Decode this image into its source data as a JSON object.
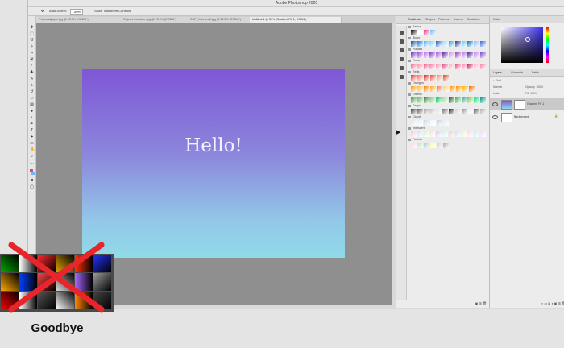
{
  "app": {
    "title": "Adobe Photoshop 2020",
    "traffic_colors": [
      "#ff5f57",
      "#febc2e",
      "#28c840"
    ]
  },
  "options_bar": {
    "auto_select": "Auto-Select:",
    "layer": "Layer",
    "show_transform": "Show Transform Controls"
  },
  "doc_tabs": [
    {
      "label": "Prismwallpaper.jpg @ 33.3% (RGB/8*)"
    },
    {
      "label": "Objects transform.jpg @ 25.0% (RGB/8*)"
    },
    {
      "label": "CGP_Hoursmall.jpg @ 25.0% (RGB/8*)"
    },
    {
      "label": "Untitled-1 @ 59% (Gradient Fill 1, RGB/8) *"
    }
  ],
  "canvas": {
    "text": "Hello!"
  },
  "gradients_panel": {
    "tabs": [
      "Gradients",
      "Shapes",
      "Patterns",
      "Layers",
      "Swatches"
    ],
    "groups": [
      {
        "name": "Basics",
        "colors": [
          "#000000",
          "#ffffff",
          "#e33b7a",
          "#6fb5ff"
        ]
      },
      {
        "name": "Blues",
        "colors": [
          "#0b4fa8",
          "#1e7ad6",
          "#58a8ee",
          "#7fd3f7",
          "#2a5fc4",
          "#9fd7ff",
          "#3aa0e0",
          "#1f3d8f",
          "#64c5e8",
          "#0e78b8",
          "#8fb8ff",
          "#3467d6"
        ]
      },
      {
        "name": "Purples",
        "colors": [
          "#6b2fbf",
          "#9a4de0",
          "#c06ae8",
          "#7c3fc2",
          "#a75bd9",
          "#5a27a8",
          "#d58cf0",
          "#8e44ad",
          "#b36be6",
          "#4b2c91",
          "#c77ff2",
          "#7a48d1"
        ]
      },
      {
        "name": "Pinks",
        "colors": [
          "#f06292",
          "#ff8a9c",
          "#e94d87",
          "#ff6f91",
          "#f48fb1",
          "#d8457e",
          "#ffa3b6",
          "#ec407a",
          "#ff7aa2",
          "#c2185b",
          "#ffb0c5",
          "#f57ba4"
        ]
      },
      {
        "name": "Reds",
        "colors": [
          "#e53935",
          "#ff6f61",
          "#c62828",
          "#f44336",
          "#ff8a65",
          "#d84315"
        ]
      },
      {
        "name": "Oranges",
        "colors": [
          "#ff9800",
          "#ffb74d",
          "#f57c00",
          "#ffa726",
          "#ff7043",
          "#ffcc80",
          "#fb8c00",
          "#ff8f00",
          "#ffb300",
          "#ef6c00"
        ]
      },
      {
        "name": "Greens",
        "colors": [
          "#43a047",
          "#66bb6a",
          "#2e7d32",
          "#81c784",
          "#00c853",
          "#a5d6a7",
          "#1b5e20",
          "#4caf50",
          "#26a69a",
          "#8bc34a",
          "#00e676",
          "#009688"
        ]
      },
      {
        "name": "Grays",
        "colors": [
          "#424242",
          "#616161",
          "#9e9e9e",
          "#bdbdbd",
          "#e0e0e0",
          "#757575",
          "#212121",
          "#cfcfcf",
          "#8a8a8a",
          "#ececec",
          "#5c5c5c",
          "#b0b0b0"
        ]
      },
      {
        "name": "Clouds",
        "colors": [
          "#d9e6f2",
          "#e8eef5",
          "#c8d8ea",
          "#f0f4f9",
          "#bcd0e6",
          "#e1ebf4"
        ]
      },
      {
        "name": "Iridescent",
        "colors": [
          "#f5c6e8",
          "#c8e6f7",
          "#d9f5c8",
          "#f7e6c8",
          "#e0c8f7",
          "#c8f7ee",
          "#f7c8d2",
          "#cfe0ff",
          "#e8f7c8",
          "#ffd6f0",
          "#c8ecf7",
          "#f2d9ff"
        ]
      },
      {
        "name": "Pastels",
        "colors": [
          "#ffd1dc",
          "#c1e1c1",
          "#aec6cf",
          "#fdfd96",
          "#cfcfc4",
          "#b39eb5"
        ]
      }
    ]
  },
  "color_panel": {
    "title": "Color"
  },
  "layers_panel": {
    "tabs": [
      "Layers",
      "Channels",
      "Paths"
    ],
    "kind": "Kind",
    "blend_mode": "Normal",
    "opacity": "Opacity: 100%",
    "lock": "Lock:",
    "fill": "Fill: 100%",
    "layers": [
      {
        "name": "Gradient Fill 1",
        "selected": true
      },
      {
        "name": "Background",
        "selected": false
      }
    ]
  },
  "overlay": {
    "caption": "Goodbye",
    "old_gradient_colors": [
      "#00aa00",
      "#ffffff",
      "#ff2a2a",
      "#e0a000",
      "#ff3300",
      "#2233ff",
      "#ffaa00",
      "#0040ff",
      "#ff4444",
      "#d9d9d9",
      "#aa66ff",
      "#9a9a9a",
      "#ff0000",
      "#ffffff",
      "#555555",
      "#ffffff",
      "#ff8800",
      "#444444"
    ],
    "cross_color": "#e8252a"
  }
}
